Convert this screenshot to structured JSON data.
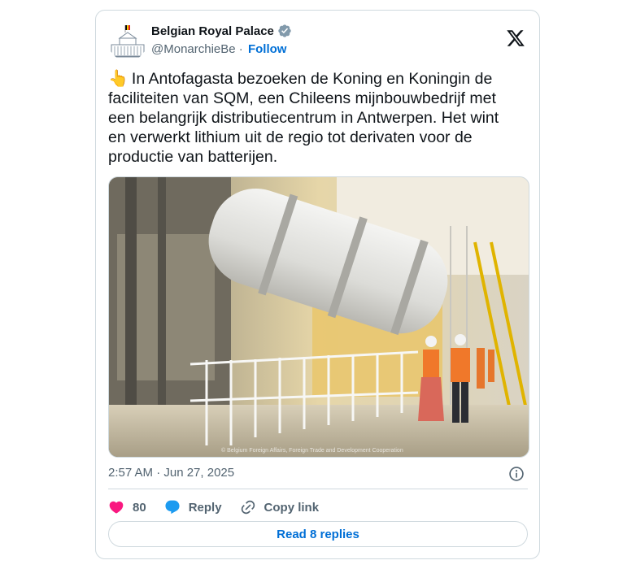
{
  "author": {
    "display_name": "Belgian Royal Palace",
    "handle": "@MonarchieBe",
    "separator": " · ",
    "follow_label": "Follow"
  },
  "tweet": {
    "emoji": "👆",
    "text": "In Antofagasta bezoeken de Koning en Koningin de faciliteiten van SQM, een Chileens mijnbouwbedrijf met een belangrijk distributiecentrum in Antwerpen. Het wint en verwerkt lithium uit de regio tot derivaten voor de productie van batterijen.",
    "timestamp": "2:57 AM · Jun 27, 2025",
    "photo_credit": "© Belgium Foreign Affairs, Foreign Trade and Development Cooperation"
  },
  "actions": {
    "like_count": "80",
    "reply_label": "Reply",
    "copy_label": "Copy link",
    "read_replies": "Read 8 replies"
  },
  "colors": {
    "accent": "#006fd6",
    "like": "#f91880",
    "reply": "#1d9bf0",
    "muted": "#536471",
    "border": "#cfd9de"
  },
  "icons": [
    "verified-badge-icon",
    "x-logo-icon",
    "info-icon",
    "heart-icon",
    "reply-bubble-icon",
    "link-icon"
  ]
}
